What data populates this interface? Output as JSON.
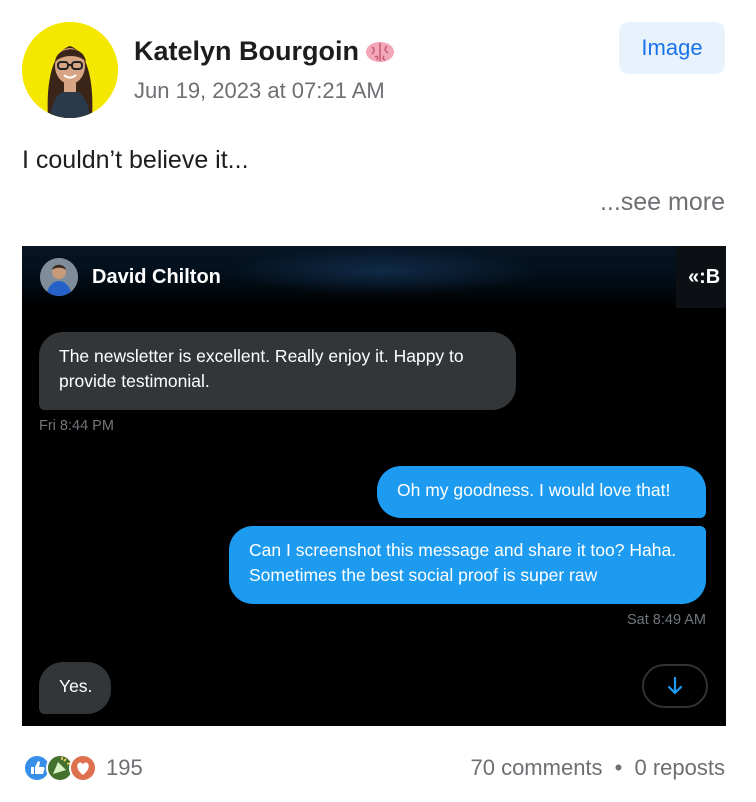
{
  "post": {
    "author": "Katelyn Bourgoin",
    "author_emoji_icon": "brain-emoji",
    "date": "Jun 19, 2023 at 07:21 AM",
    "badge": "Image",
    "text": "I couldn’t believe it...",
    "see_more": "...see more"
  },
  "screenshot": {
    "contact_name": "David Chilton",
    "corner_text": "«:B",
    "messages": [
      {
        "direction": "incoming",
        "text": "The newsletter is excellent. Really enjoy it. Happy to provide testimonial."
      },
      {
        "direction": "outgoing",
        "text": "Oh my goodness. I would love that!"
      },
      {
        "direction": "outgoing",
        "text": "Can I screenshot this message and share it too? Haha. Sometimes the best social proof is super raw"
      },
      {
        "direction": "incoming",
        "text": "Yes."
      }
    ],
    "timestamps": [
      "Fri 8:44 PM",
      "Sat 8:49 AM"
    ],
    "scroll_icon": "arrow-down-icon",
    "colors": {
      "incoming": "#333639",
      "outgoing": "#1d9bf0",
      "background": "#000000"
    }
  },
  "footer": {
    "reaction_icons": [
      "like-icon",
      "celebrate-icon",
      "love-icon"
    ],
    "reaction_count": "195",
    "comments": "70 comments",
    "separator": "•",
    "reposts": "0 reposts"
  }
}
